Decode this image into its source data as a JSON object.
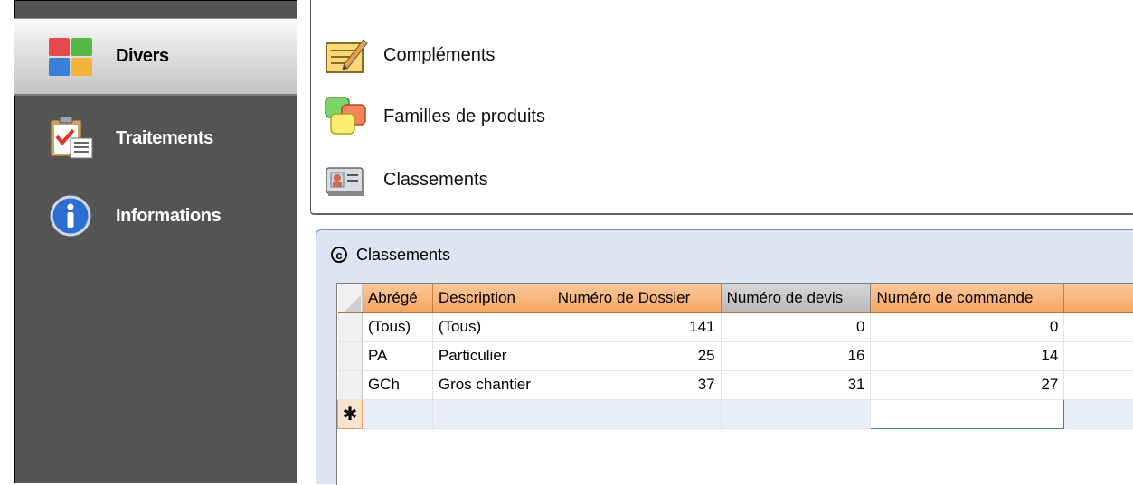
{
  "sidebar": {
    "items": [
      {
        "label": "Divers",
        "icon": "colored-grid-icon"
      },
      {
        "label": "Traitements",
        "icon": "clipboard-checklist-icon"
      },
      {
        "label": "Informations",
        "icon": "info-icon"
      }
    ]
  },
  "menu": {
    "items": [
      {
        "label": "Compléments",
        "icon": "notepad-pencil-icon"
      },
      {
        "label": "Familles de produits",
        "icon": "overlapping-squares-icon"
      },
      {
        "label": "Classements",
        "icon": "id-card-icon"
      }
    ]
  },
  "window": {
    "title": "Classements",
    "title_icon_glyph": "c"
  },
  "grid": {
    "columns": [
      "Abrégé",
      "Description",
      "Numéro de Dossier",
      "Numéro de devis",
      "Numéro de commande"
    ],
    "rows": [
      {
        "abrege": "(Tous)",
        "description": "(Tous)",
        "dossier": "141",
        "devis": "0",
        "commande": "0"
      },
      {
        "abrege": "PA",
        "description": "Particulier",
        "dossier": "25",
        "devis": "16",
        "commande": "14"
      },
      {
        "abrege": "GCh",
        "description": "Gros chantier",
        "dossier": "37",
        "devis": "31",
        "commande": "27"
      }
    ],
    "new_row_marker": "✱"
  },
  "colors": {
    "header_orange": "#f5a662",
    "sidebar_dark": "#545454",
    "window_bg": "#dce6f2"
  }
}
